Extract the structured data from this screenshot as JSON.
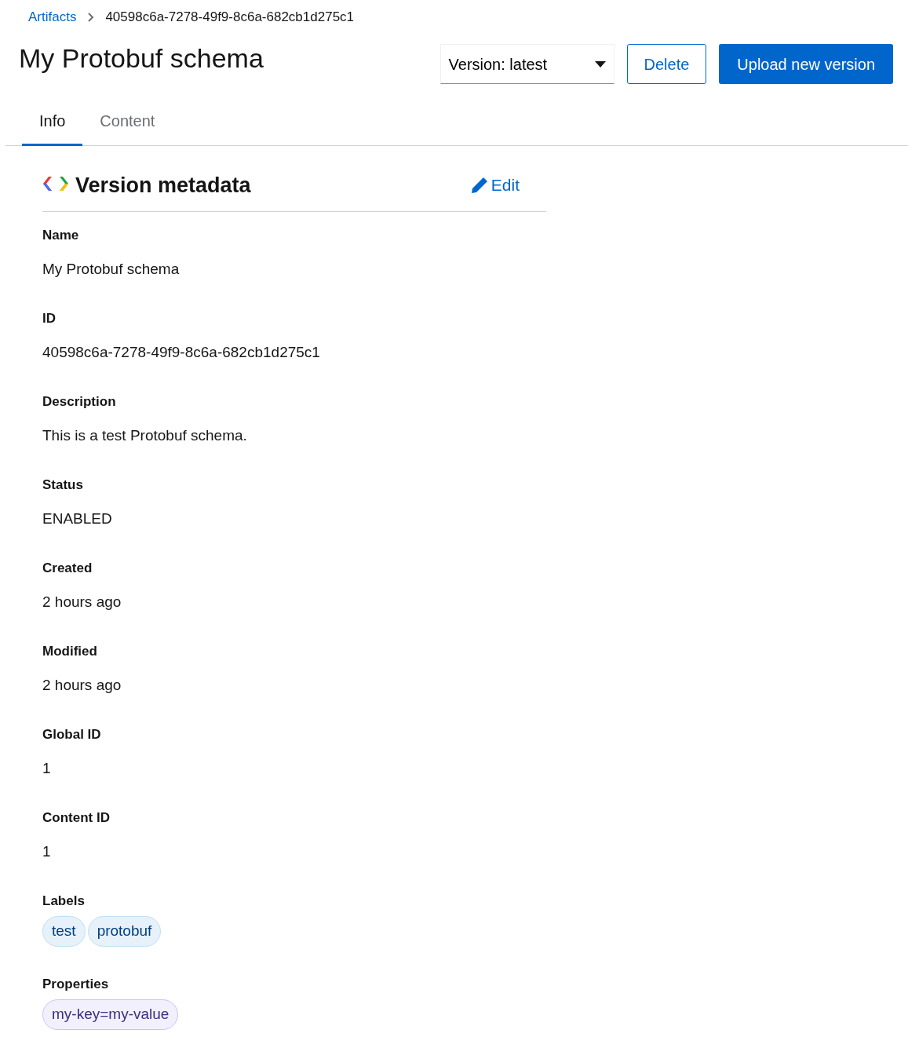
{
  "breadcrumb": [
    {
      "label": "Artifacts",
      "kind": "link"
    },
    {
      "label": "40598c6a-7278-49f9-8c6a-682cb1d275c1",
      "kind": "current"
    }
  ],
  "title": "My Protobuf schema",
  "version_select": {
    "value": "Version: latest"
  },
  "buttons": [
    {
      "label": "Delete",
      "kind": "secondary"
    },
    {
      "label": "Upload new version",
      "kind": "primary"
    }
  ],
  "tabs": [
    {
      "label": "Info",
      "selected": true
    },
    {
      "label": "Content",
      "selected": false
    }
  ],
  "section": {
    "title": "Version metadata",
    "edit": "Edit"
  },
  "fields": [
    {
      "label": "Name",
      "kind": "text",
      "value": "My Protobuf schema"
    },
    {
      "label": "ID",
      "kind": "text",
      "value": "40598c6a-7278-49f9-8c6a-682cb1d275c1"
    },
    {
      "label": "Description",
      "kind": "text",
      "value": "This is a test Protobuf schema."
    },
    {
      "label": "Status",
      "kind": "text",
      "value": "ENABLED"
    },
    {
      "label": "Created",
      "kind": "text",
      "value": "2 hours ago"
    },
    {
      "label": "Modified",
      "kind": "text",
      "value": "2 hours ago"
    },
    {
      "label": "Global ID",
      "kind": "text",
      "value": "1"
    },
    {
      "label": "Content ID",
      "kind": "text",
      "value": "1"
    },
    {
      "label": "Labels",
      "kind": "labels",
      "chips": [
        "test",
        "protobuf"
      ]
    },
    {
      "label": "Properties",
      "kind": "properties",
      "chips": [
        "my-key=my-value"
      ]
    }
  ]
}
